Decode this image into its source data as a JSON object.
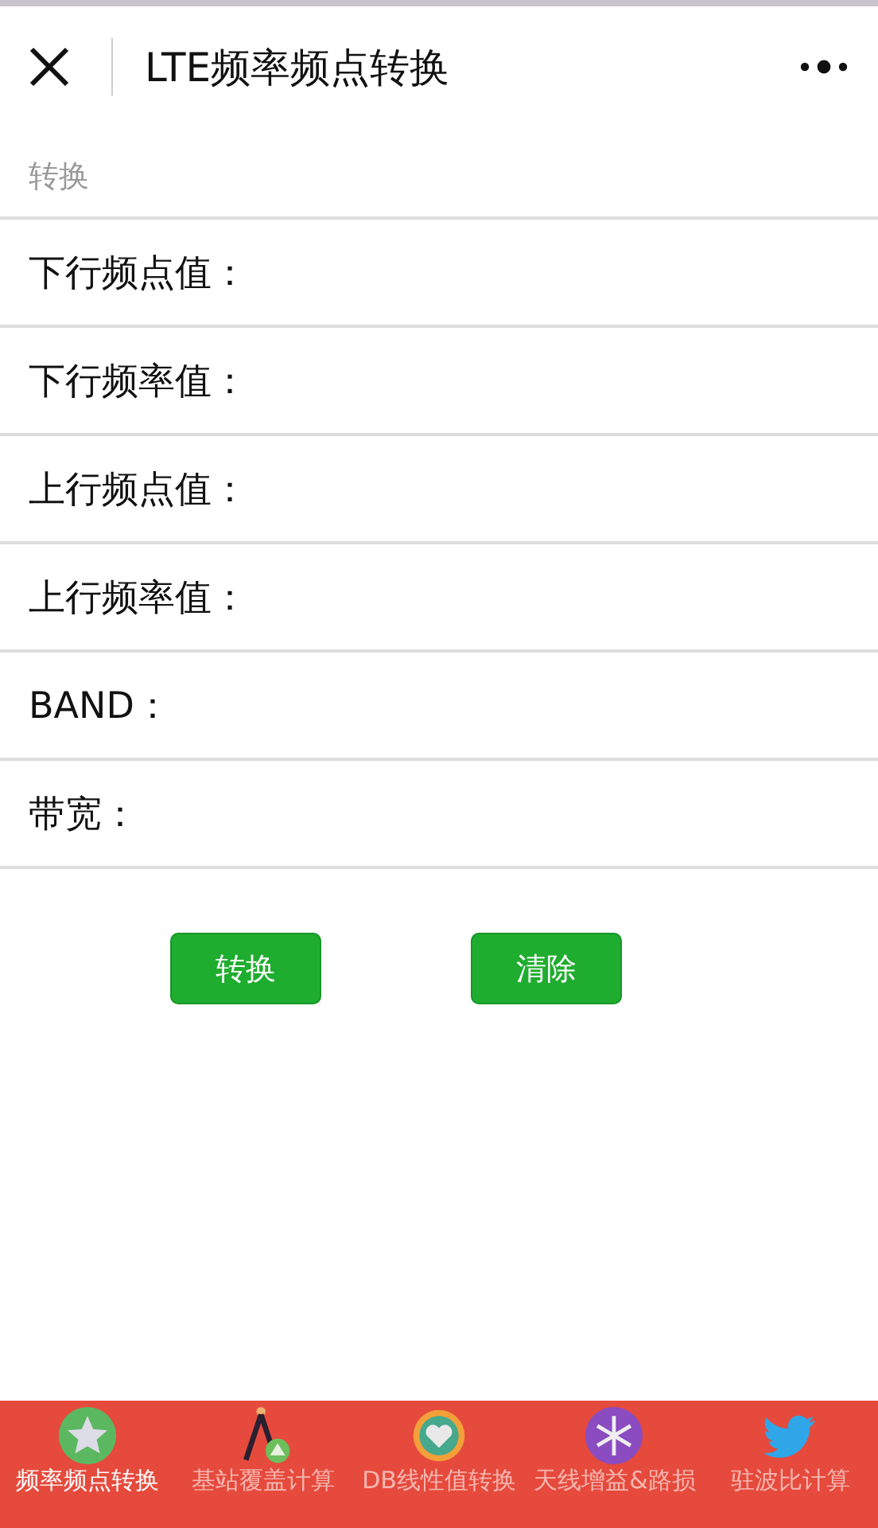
{
  "header": {
    "title": "LTE频率频点转换"
  },
  "section_title": "转换",
  "fields": [
    {
      "label": "下行频点值："
    },
    {
      "label": "下行频率值："
    },
    {
      "label": "上行频点值："
    },
    {
      "label": "上行频率值："
    },
    {
      "label": "BAND："
    },
    {
      "label": "带宽："
    }
  ],
  "buttons": [
    "转换",
    "清除"
  ],
  "tabs": [
    {
      "label": "频率频点转换",
      "selected": true
    },
    {
      "label": "基站覆盖计算",
      "selected": false
    },
    {
      "label": "DB线性值转换",
      "selected": false
    },
    {
      "label": "天线增益&路损",
      "selected": false
    },
    {
      "label": "驻波比计算",
      "selected": false
    }
  ]
}
